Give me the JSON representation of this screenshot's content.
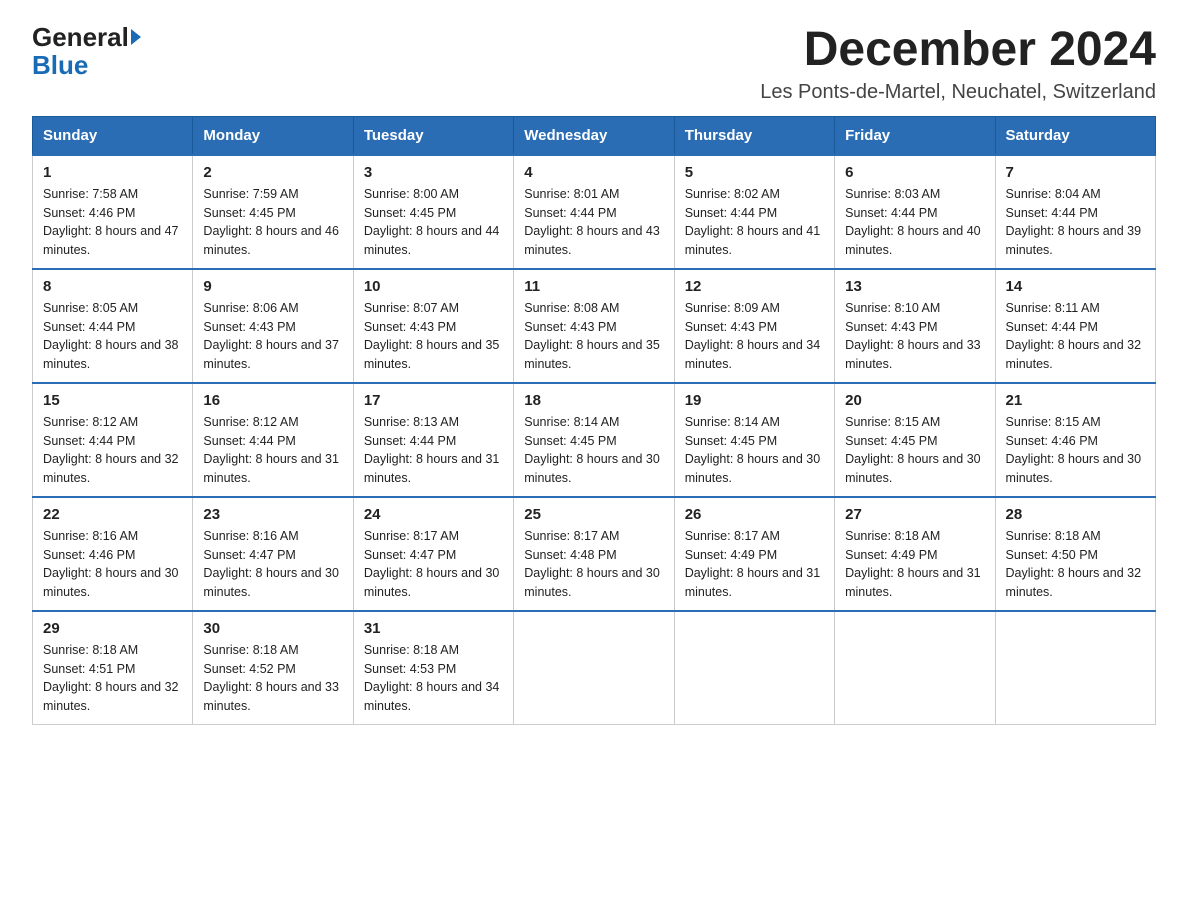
{
  "header": {
    "logo_line1": "General",
    "logo_line2": "Blue",
    "title": "December 2024",
    "subtitle": "Les Ponts-de-Martel, Neuchatel, Switzerland"
  },
  "days_of_week": [
    "Sunday",
    "Monday",
    "Tuesday",
    "Wednesday",
    "Thursday",
    "Friday",
    "Saturday"
  ],
  "weeks": [
    [
      {
        "day": "1",
        "sunrise": "7:58 AM",
        "sunset": "4:46 PM",
        "daylight": "8 hours and 47 minutes."
      },
      {
        "day": "2",
        "sunrise": "7:59 AM",
        "sunset": "4:45 PM",
        "daylight": "8 hours and 46 minutes."
      },
      {
        "day": "3",
        "sunrise": "8:00 AM",
        "sunset": "4:45 PM",
        "daylight": "8 hours and 44 minutes."
      },
      {
        "day": "4",
        "sunrise": "8:01 AM",
        "sunset": "4:44 PM",
        "daylight": "8 hours and 43 minutes."
      },
      {
        "day": "5",
        "sunrise": "8:02 AM",
        "sunset": "4:44 PM",
        "daylight": "8 hours and 41 minutes."
      },
      {
        "day": "6",
        "sunrise": "8:03 AM",
        "sunset": "4:44 PM",
        "daylight": "8 hours and 40 minutes."
      },
      {
        "day": "7",
        "sunrise": "8:04 AM",
        "sunset": "4:44 PM",
        "daylight": "8 hours and 39 minutes."
      }
    ],
    [
      {
        "day": "8",
        "sunrise": "8:05 AM",
        "sunset": "4:44 PM",
        "daylight": "8 hours and 38 minutes."
      },
      {
        "day": "9",
        "sunrise": "8:06 AM",
        "sunset": "4:43 PM",
        "daylight": "8 hours and 37 minutes."
      },
      {
        "day": "10",
        "sunrise": "8:07 AM",
        "sunset": "4:43 PM",
        "daylight": "8 hours and 35 minutes."
      },
      {
        "day": "11",
        "sunrise": "8:08 AM",
        "sunset": "4:43 PM",
        "daylight": "8 hours and 35 minutes."
      },
      {
        "day": "12",
        "sunrise": "8:09 AM",
        "sunset": "4:43 PM",
        "daylight": "8 hours and 34 minutes."
      },
      {
        "day": "13",
        "sunrise": "8:10 AM",
        "sunset": "4:43 PM",
        "daylight": "8 hours and 33 minutes."
      },
      {
        "day": "14",
        "sunrise": "8:11 AM",
        "sunset": "4:44 PM",
        "daylight": "8 hours and 32 minutes."
      }
    ],
    [
      {
        "day": "15",
        "sunrise": "8:12 AM",
        "sunset": "4:44 PM",
        "daylight": "8 hours and 32 minutes."
      },
      {
        "day": "16",
        "sunrise": "8:12 AM",
        "sunset": "4:44 PM",
        "daylight": "8 hours and 31 minutes."
      },
      {
        "day": "17",
        "sunrise": "8:13 AM",
        "sunset": "4:44 PM",
        "daylight": "8 hours and 31 minutes."
      },
      {
        "day": "18",
        "sunrise": "8:14 AM",
        "sunset": "4:45 PM",
        "daylight": "8 hours and 30 minutes."
      },
      {
        "day": "19",
        "sunrise": "8:14 AM",
        "sunset": "4:45 PM",
        "daylight": "8 hours and 30 minutes."
      },
      {
        "day": "20",
        "sunrise": "8:15 AM",
        "sunset": "4:45 PM",
        "daylight": "8 hours and 30 minutes."
      },
      {
        "day": "21",
        "sunrise": "8:15 AM",
        "sunset": "4:46 PM",
        "daylight": "8 hours and 30 minutes."
      }
    ],
    [
      {
        "day": "22",
        "sunrise": "8:16 AM",
        "sunset": "4:46 PM",
        "daylight": "8 hours and 30 minutes."
      },
      {
        "day": "23",
        "sunrise": "8:16 AM",
        "sunset": "4:47 PM",
        "daylight": "8 hours and 30 minutes."
      },
      {
        "day": "24",
        "sunrise": "8:17 AM",
        "sunset": "4:47 PM",
        "daylight": "8 hours and 30 minutes."
      },
      {
        "day": "25",
        "sunrise": "8:17 AM",
        "sunset": "4:48 PM",
        "daylight": "8 hours and 30 minutes."
      },
      {
        "day": "26",
        "sunrise": "8:17 AM",
        "sunset": "4:49 PM",
        "daylight": "8 hours and 31 minutes."
      },
      {
        "day": "27",
        "sunrise": "8:18 AM",
        "sunset": "4:49 PM",
        "daylight": "8 hours and 31 minutes."
      },
      {
        "day": "28",
        "sunrise": "8:18 AM",
        "sunset": "4:50 PM",
        "daylight": "8 hours and 32 minutes."
      }
    ],
    [
      {
        "day": "29",
        "sunrise": "8:18 AM",
        "sunset": "4:51 PM",
        "daylight": "8 hours and 32 minutes."
      },
      {
        "day": "30",
        "sunrise": "8:18 AM",
        "sunset": "4:52 PM",
        "daylight": "8 hours and 33 minutes."
      },
      {
        "day": "31",
        "sunrise": "8:18 AM",
        "sunset": "4:53 PM",
        "daylight": "8 hours and 34 minutes."
      },
      null,
      null,
      null,
      null
    ]
  ]
}
